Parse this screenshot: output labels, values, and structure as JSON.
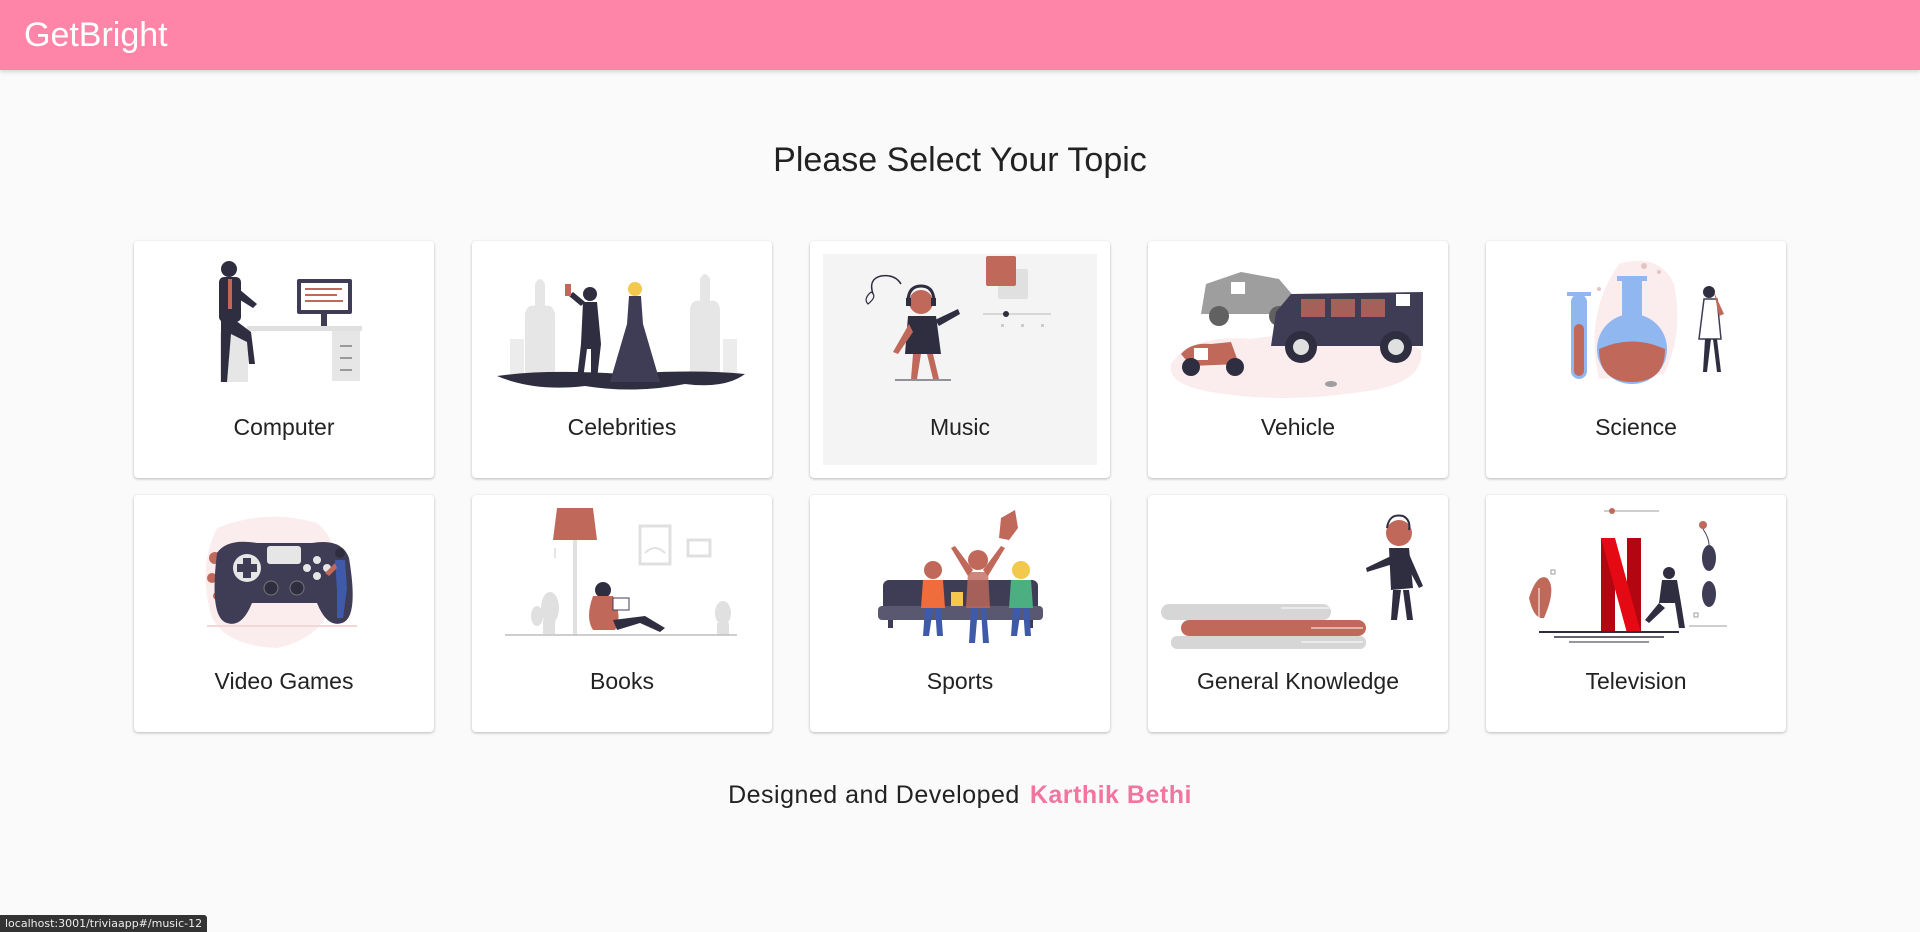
{
  "app": {
    "brand": "GetBright"
  },
  "page": {
    "heading": "Please Select Your Topic"
  },
  "topics": [
    {
      "label": "Computer"
    },
    {
      "label": "Celebrities"
    },
    {
      "label": "Music"
    },
    {
      "label": "Vehicle"
    },
    {
      "label": "Science"
    },
    {
      "label": "Video Games"
    },
    {
      "label": "Books"
    },
    {
      "label": "Sports"
    },
    {
      "label": "General Knowledge"
    },
    {
      "label": "Television"
    }
  ],
  "footer": {
    "text": "Designed and Developed",
    "author": "Karthik Bethi"
  },
  "status": {
    "url": "localhost:3001/triviaapp#/music-12"
  },
  "colors": {
    "appbar": "#ff85a8",
    "accent": "#f3749f",
    "illustration_accent": "#c0695b",
    "dark": "#3f3d56"
  }
}
